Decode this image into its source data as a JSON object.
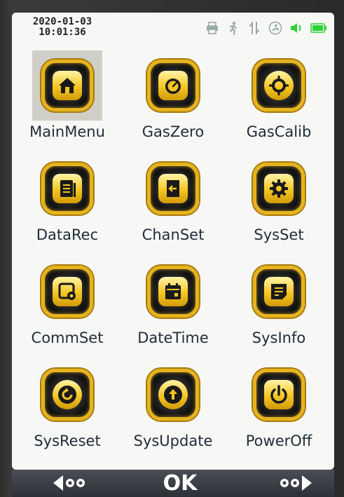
{
  "status": {
    "date": "2020-01-03",
    "time": "10:01:36",
    "icons": [
      "printer-icon",
      "walking-person-icon",
      "signal-icon",
      "fan-icon",
      "speaker-icon",
      "battery-icon"
    ],
    "accent_color": "#2fd13a"
  },
  "menu": {
    "selected_index": 0,
    "items": [
      {
        "label": "MainMenu",
        "icon": "home-icon"
      },
      {
        "label": "GasZero",
        "icon": "gauge-icon"
      },
      {
        "label": "GasCalib",
        "icon": "calibrate-icon"
      },
      {
        "label": "DataRec",
        "icon": "document-icon"
      },
      {
        "label": "ChanSet",
        "icon": "door-enter-icon"
      },
      {
        "label": "SysSet",
        "icon": "gear-icon"
      },
      {
        "label": "CommSet",
        "icon": "comm-settings-icon"
      },
      {
        "label": "DateTime",
        "icon": "calendar-icon"
      },
      {
        "label": "SysInfo",
        "icon": "info-note-icon"
      },
      {
        "label": "SysReset",
        "icon": "reset-icon"
      },
      {
        "label": "SysUpdate",
        "icon": "upload-icon"
      },
      {
        "label": "PowerOff",
        "icon": "power-icon"
      }
    ]
  },
  "nav": {
    "ok_label": "OK",
    "left_icon": "left-arrow-icon",
    "right_icon": "right-arrow-icon"
  },
  "colors": {
    "tile_border": "#e6b31e",
    "badge_gold": "#f5c622",
    "label_text": "#1f2c3a",
    "bottom_bar": "#3a3d45"
  }
}
